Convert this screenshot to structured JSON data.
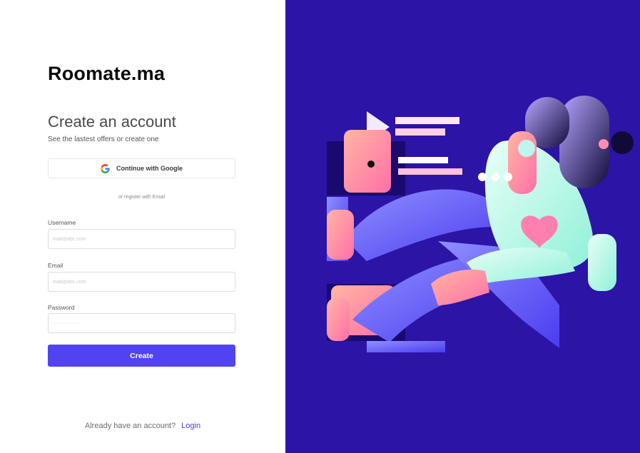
{
  "brand": {
    "name": "Roomate.ma"
  },
  "header": {
    "title": "Create an account",
    "subtitle": "See the lastest offers or create one"
  },
  "google": {
    "label": "Continue with Google",
    "icon": "google-g-icon"
  },
  "divider": {
    "text": "or register with Email"
  },
  "form": {
    "username": {
      "label": "Username",
      "placeholder": "mail@abc.com",
      "value": ""
    },
    "email": {
      "label": "Email",
      "placeholder": "mail@abc.com",
      "value": ""
    },
    "password": {
      "label": "Password",
      "placeholder": "·················",
      "value": ""
    },
    "submit_label": "Create"
  },
  "footer": {
    "prompt": "Already have an account?",
    "link": "Login"
  },
  "colors": {
    "accent": "#5243f0",
    "link": "#4a3be8",
    "panel": "#2c14a6",
    "illustration_purple": "#6b6bff",
    "illustration_pink": "#ff8fb1",
    "illustration_mint": "#c9fff0"
  }
}
